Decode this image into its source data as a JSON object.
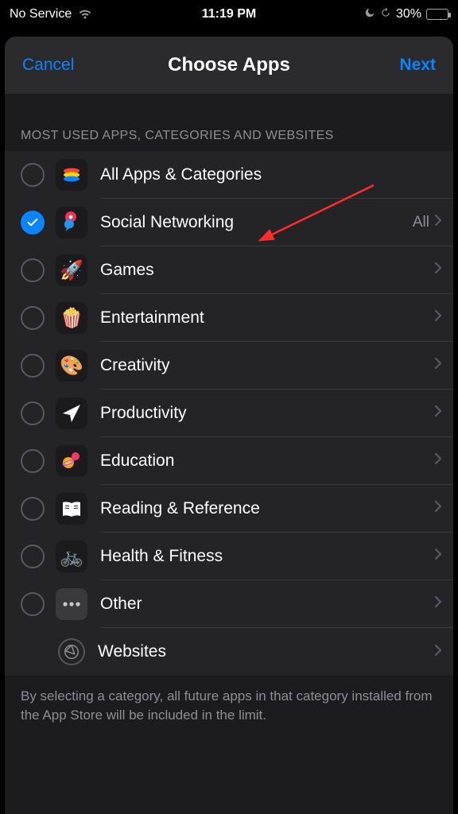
{
  "statusbar": {
    "service": "No Service",
    "time": "11:19 PM",
    "battery_percent": "30%"
  },
  "navbar": {
    "cancel": "Cancel",
    "title": "Choose Apps",
    "next": "Next"
  },
  "section_header": "MOST USED APPS, CATEGORIES AND WEBSITES",
  "rows": {
    "all": {
      "label": "All Apps & Categories"
    },
    "social": {
      "label": "Social Networking",
      "detail": "All"
    },
    "games": {
      "label": "Games"
    },
    "entertainment": {
      "label": "Entertainment"
    },
    "creativity": {
      "label": "Creativity"
    },
    "productivity": {
      "label": "Productivity"
    },
    "education": {
      "label": "Education"
    },
    "reading": {
      "label": "Reading & Reference"
    },
    "health": {
      "label": "Health & Fitness"
    },
    "other": {
      "label": "Other"
    },
    "websites": {
      "label": "Websites"
    }
  },
  "footer": "By selecting a category, all future apps in that category installed from the App Store will be included in the limit."
}
